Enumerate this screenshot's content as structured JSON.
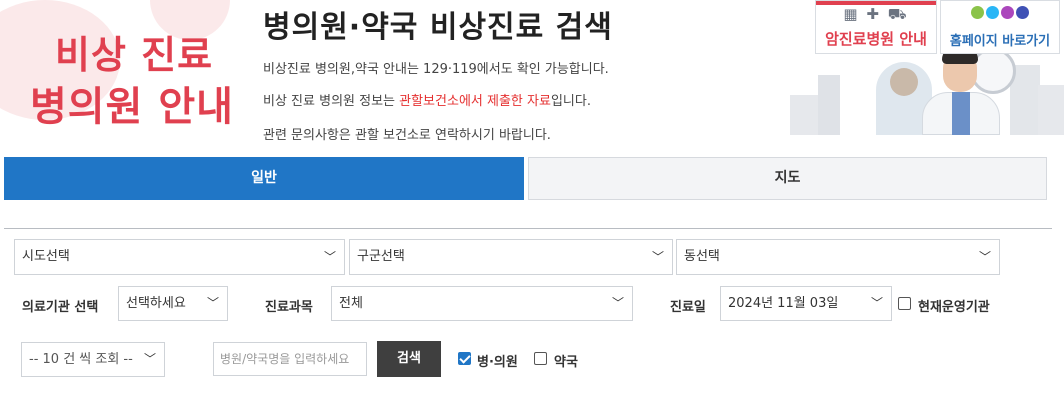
{
  "header": {
    "logo_line1": "비상 진료",
    "logo_line2": "병의원 안내",
    "title": "병의원·약국 비상진료 검색",
    "info1": "비상진료 병의원,약국 안내는 129·119에서도 확인 가능합니다.",
    "info2_pre": "비상 진료 병의원 정보는 ",
    "info2_red": "관할보건소에서 제출한 자료",
    "info2_post": "입니다.",
    "info3": "관련 문의사항은 관할 보건소로 연락하시기 바랍니다."
  },
  "promo": {
    "cancer_hospital_label": "암진료병원 안내",
    "homepage_label": "홈페이지 바로가기",
    "colors": {
      "red": "#e0404f",
      "blue": "#2b6fb6"
    }
  },
  "tabs": [
    {
      "label": "일반",
      "active": true
    },
    {
      "label": "지도",
      "active": false
    }
  ],
  "filters": {
    "sido": "시도선택",
    "gugun": "구군선택",
    "dong": "동선택",
    "institution_label": "의료기관 선택",
    "institution_value": "선택하세요",
    "department_label": "진료과목",
    "department_value": "전체",
    "date_label": "진료일",
    "date_value": "2024년 11월 03일",
    "open_now_label": "현재운영기관",
    "page_size": "-- 10 건 씩 조회 --",
    "search_placeholder": "병원/약국명을 입력하세요",
    "search_button": "검색",
    "hospital_check_label": "병·의원",
    "pharmacy_check_label": "약국"
  },
  "colors": {
    "accent": "#2076c6",
    "logo_red": "#e0404f",
    "notice_red": "#e53030"
  }
}
